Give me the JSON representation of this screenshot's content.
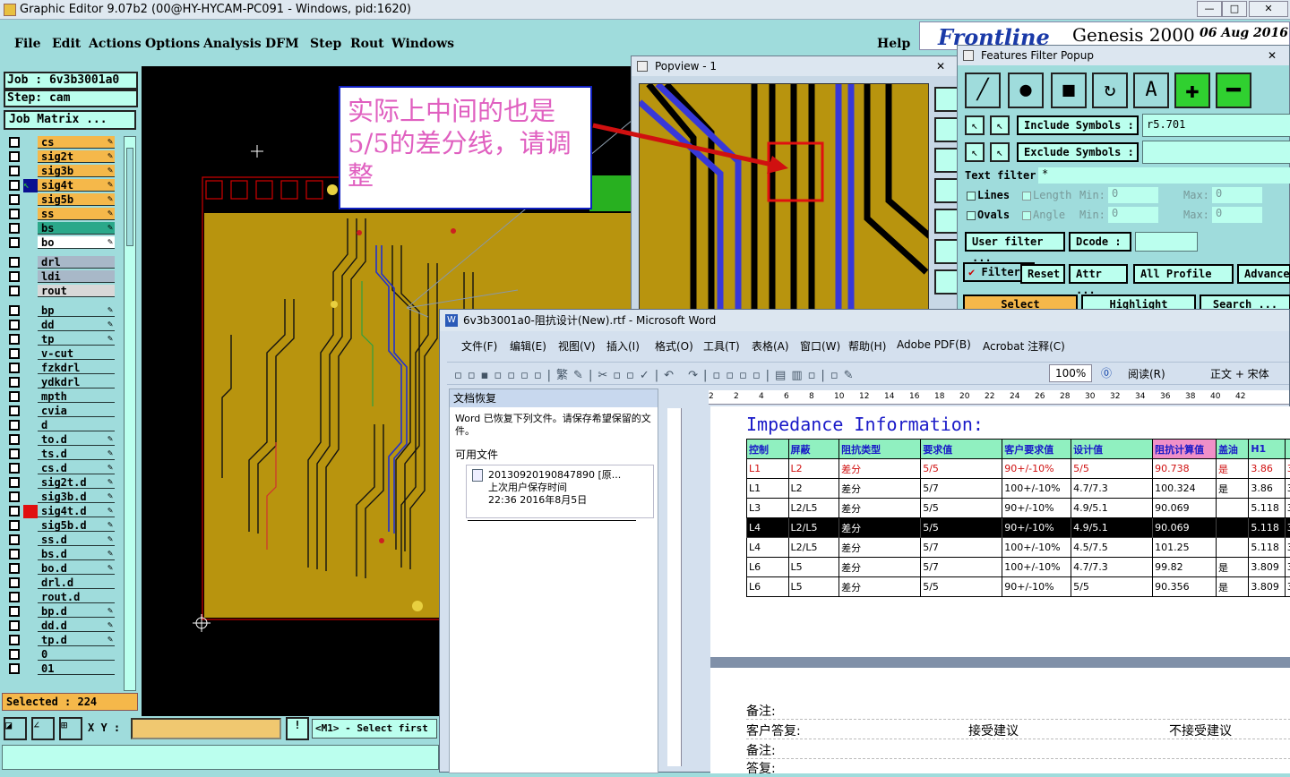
{
  "main_window": {
    "title": "Graphic Editor 9.07b2 (00@HY-HYCAM-PC091 - Windows, pid:1620)",
    "minimize": "—",
    "maximize": "□",
    "close": "✕"
  },
  "menu": {
    "items": [
      "File",
      "Edit",
      "Actions",
      "Options",
      "Analysis",
      "DFM",
      "Step",
      "Rout",
      "Windows"
    ],
    "help": "Help"
  },
  "brand": {
    "logo": "Frontline",
    "product": "Genesis 2000",
    "date": "06 Aug 2016"
  },
  "left_panel": {
    "job_label": "Job : 6v3b3001a0",
    "step_label": "Step: cam",
    "job_matrix": "Job Matrix ...",
    "layers_group1": [
      {
        "name": "cs",
        "color": "#f5b84a",
        "pen": true
      },
      {
        "name": "sig2t",
        "color": "#f5b84a",
        "pen": true
      },
      {
        "name": "sig3b",
        "color": "#f5b84a",
        "pen": true
      },
      {
        "name": "sig4t",
        "color": "#f5b84a",
        "pen": true,
        "active": true
      },
      {
        "name": "sig5b",
        "color": "#f5b84a",
        "pen": true
      },
      {
        "name": "ss",
        "color": "#f5b84a",
        "pen": true
      },
      {
        "name": "bs",
        "color": "#2aa88a",
        "pen": true
      },
      {
        "name": "bo",
        "color": "#ffffff",
        "pen": true
      }
    ],
    "layers_group2": [
      {
        "name": "drl",
        "color": "#a8b8c8"
      },
      {
        "name": "ldi",
        "color": "#a8b8c8"
      },
      {
        "name": "rout",
        "color": "#d8d8d8"
      }
    ],
    "layers_group3": [
      {
        "name": "bp",
        "pen": true
      },
      {
        "name": "dd",
        "pen": true
      },
      {
        "name": "tp",
        "pen": true
      },
      {
        "name": "v-cut"
      },
      {
        "name": "fzkdrl"
      },
      {
        "name": "ydkdrl"
      },
      {
        "name": "mpth"
      },
      {
        "name": "cvia"
      },
      {
        "name": "d"
      },
      {
        "name": "to.d",
        "pen": true
      },
      {
        "name": "ts.d",
        "pen": true
      },
      {
        "name": "cs.d",
        "pen": true
      },
      {
        "name": "sig2t.d",
        "pen": true
      },
      {
        "name": "sig3b.d",
        "pen": true
      },
      {
        "name": "sig4t.d",
        "pen": true,
        "marked": true
      },
      {
        "name": "sig5b.d",
        "pen": true
      },
      {
        "name": "ss.d",
        "pen": true
      },
      {
        "name": "bs.d",
        "pen": true
      },
      {
        "name": "bo.d",
        "pen": true
      },
      {
        "name": "drl.d"
      },
      {
        "name": "rout.d"
      },
      {
        "name": "bp.d",
        "pen": true
      },
      {
        "name": "dd.d",
        "pen": true
      },
      {
        "name": "tp.d",
        "pen": true
      },
      {
        "name": "0"
      },
      {
        "name": "01"
      }
    ],
    "selected": "Selected : 224"
  },
  "bottom": {
    "xy_label": "X Y :",
    "status": "<M1> - Select first"
  },
  "annotation": {
    "text": "实际上中间的也是5/5的差分线，请调整"
  },
  "popview": {
    "title": "Popview - 1",
    "close": "✕"
  },
  "features_filter": {
    "title": "Features Filter Popup",
    "include_symbols": "Include Symbols :",
    "include_value": "r5.701",
    "exclude_symbols": "Exclude Symbols :",
    "text_filter": "Text filter",
    "text_filter_value": "*",
    "lines": "Lines",
    "ovals": "Ovals",
    "length": "Length",
    "angle": "Angle",
    "min": "Min:",
    "max": "Max:",
    "zero": "0",
    "user_filter": "User filter ...",
    "dcode": "Dcode :",
    "filter": "Filter",
    "reset": "Reset",
    "attr": "Attr ...",
    "all_profile": "All Profile",
    "advanced": "Advanced",
    "select": "Select",
    "highlight": "Highlight",
    "search": "Search ...",
    "close": "✕"
  },
  "word": {
    "title": "6v3b3001a0-阻抗设计(New).rtf - Microsoft Word",
    "menu": [
      "文件(F)",
      "编辑(E)",
      "视图(V)",
      "插入(I)",
      "格式(O)",
      "工具(T)",
      "表格(A)",
      "窗口(W)",
      "帮助(H)",
      "Adobe PDF(B)",
      "Acrobat 注释(C)"
    ],
    "zoom": "100%",
    "reading": "阅读(R)",
    "style": "正文 + 宋体",
    "recovery_title": "文档恢复",
    "recovery_text": "Word 已恢复下列文件。请保存希望保留的文件。",
    "available_files": "可用文件",
    "file_name": "20130920190847890 [原...",
    "file_sub": "上次用户保存时间",
    "file_time": "22:36 2016年8月5日",
    "ruler_marks": [
      "2",
      "2",
      "4",
      "6",
      "8",
      "10",
      "12",
      "14",
      "16",
      "18",
      "20",
      "22",
      "24",
      "26",
      "28",
      "30",
      "32",
      "34",
      "36",
      "38",
      "40",
      "42"
    ],
    "heading": "Impedance Information:",
    "headers": [
      "控制",
      "屏蔽",
      "阻抗类型",
      "要求值",
      "客户要求值",
      "设计值",
      "阻抗计算值",
      "盖油",
      "H1",
      ""
    ],
    "rows": [
      [
        "L1",
        "L2",
        "差分",
        "5/5",
        "90+/-10%",
        "5/5",
        "90.738",
        "是",
        "3.86",
        "3"
      ],
      [
        "L1",
        "L2",
        "差分",
        "5/7",
        "100+/-10%",
        "4.7/7.3",
        "100.324",
        "是",
        "3.86",
        "3"
      ],
      [
        "L3",
        "L2/L5",
        "差分",
        "5/5",
        "90+/-10%",
        "4.9/5.1",
        "90.069",
        "",
        "5.118",
        "3"
      ],
      [
        "L4",
        "L2/L5",
        "差分",
        "5/5",
        "90+/-10%",
        "4.9/5.1",
        "90.069",
        "",
        "5.118",
        "3"
      ],
      [
        "L4",
        "L2/L5",
        "差分",
        "5/7",
        "100+/-10%",
        "4.5/7.5",
        "101.25",
        "",
        "5.118",
        "3"
      ],
      [
        "L6",
        "L5",
        "差分",
        "5/7",
        "100+/-10%",
        "4.7/7.3",
        "99.82",
        "是",
        "3.809",
        "3"
      ],
      [
        "L6",
        "L5",
        "差分",
        "5/5",
        "90+/-10%",
        "5/5",
        "90.356",
        "是",
        "3.809",
        "3"
      ]
    ],
    "note1": "备注:",
    "reply1": "客户答复:",
    "accept": "接受建议",
    "reject": "不接受建议",
    "note2": "备注:",
    "reply2": "答复:"
  },
  "colors": {
    "teal": "#9fdcdc",
    "board": "#b8940e",
    "layer_orange": "#f5b84a",
    "annot_text": "#e060c0"
  }
}
